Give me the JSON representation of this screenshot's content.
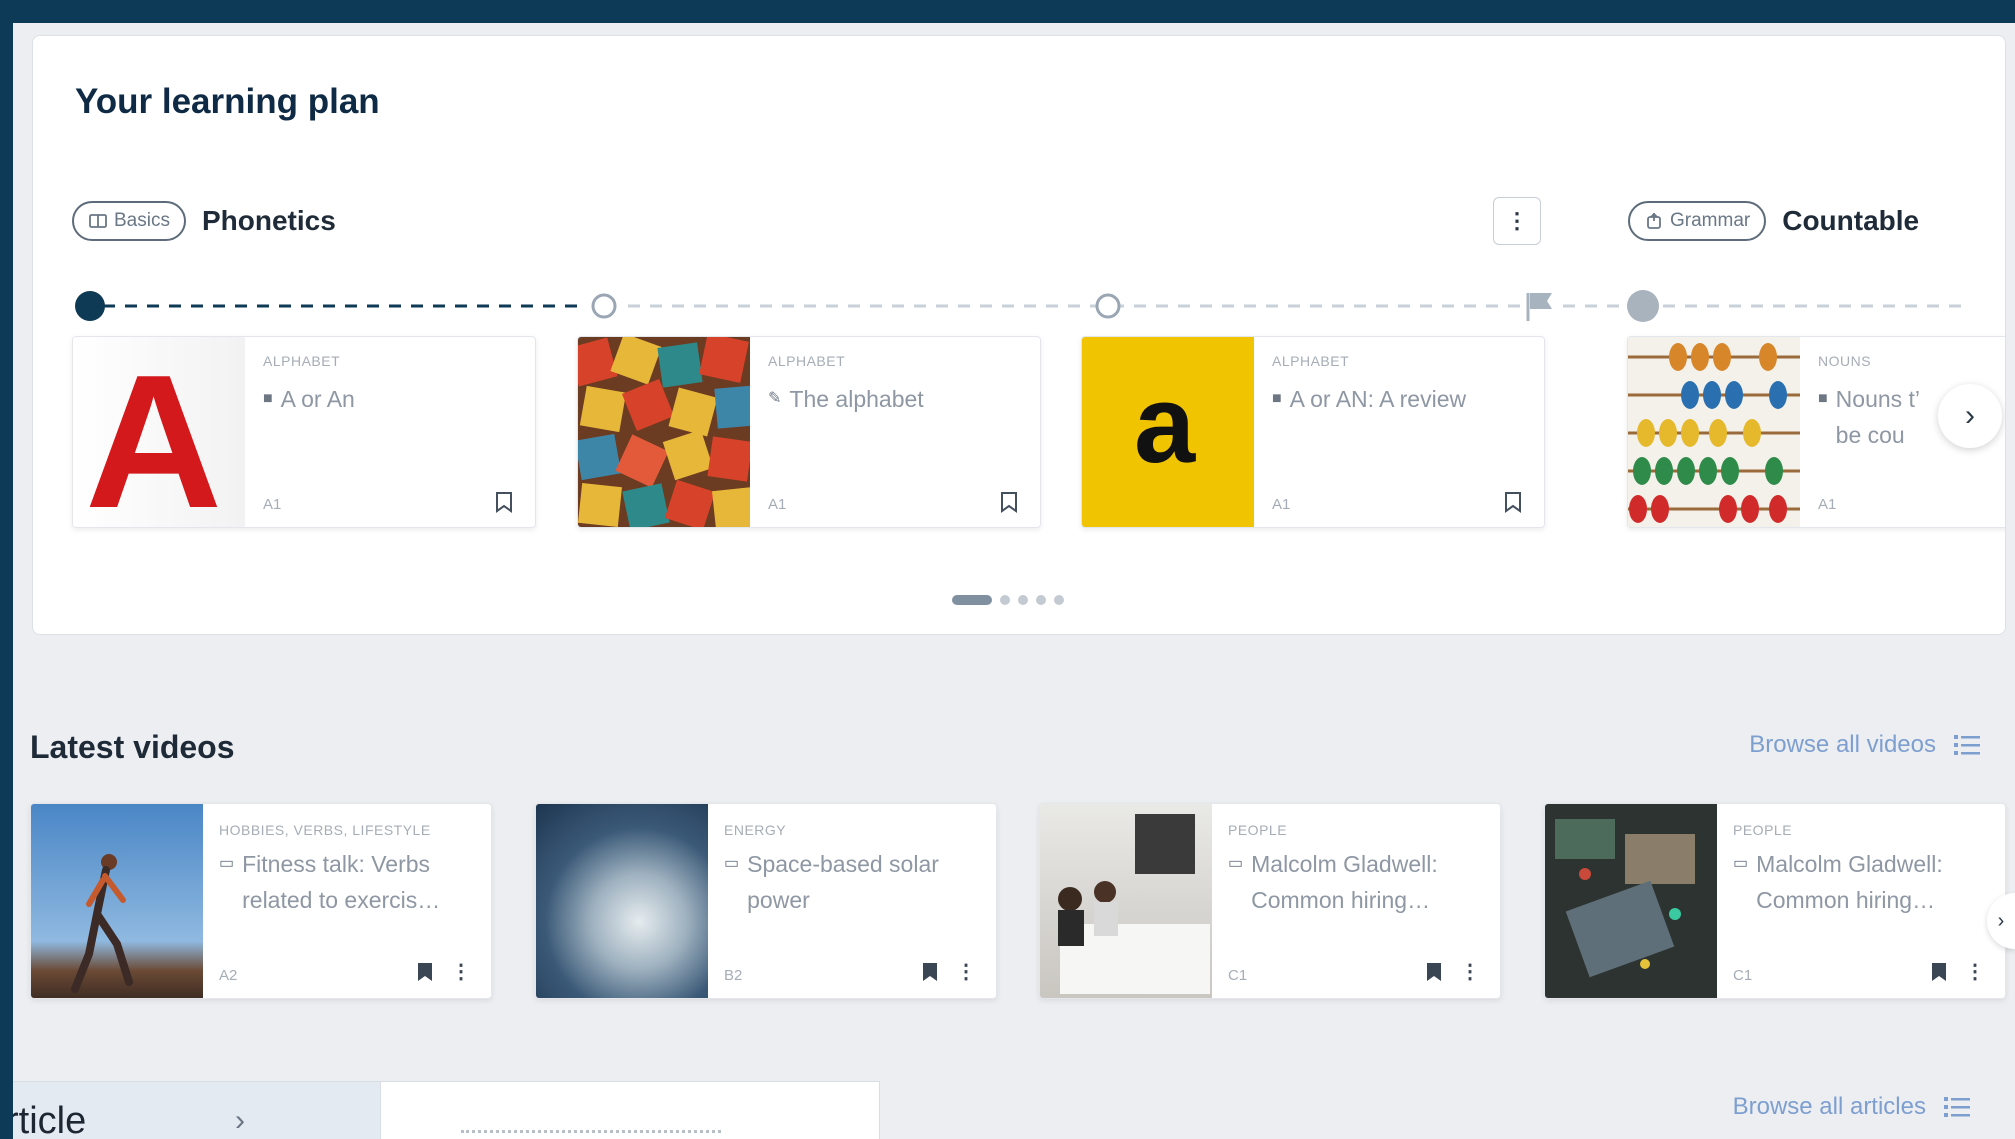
{
  "learning_plan": {
    "title": "Your learning plan",
    "topics": [
      {
        "chip": "Basics",
        "chip_icon": "book-icon",
        "name": "Phonetics"
      },
      {
        "chip": "Grammar",
        "chip_icon": "grammar-icon",
        "name": "Countable"
      }
    ],
    "cards": [
      {
        "category": "ALPHABET",
        "title": "A or An",
        "title_icon": "book-icon",
        "level": "A1",
        "thumb": "letter-a-red"
      },
      {
        "category": "ALPHABET",
        "title": "The alphabet",
        "title_icon": "pen-icon",
        "level": "A1",
        "thumb": "letter-blocks"
      },
      {
        "category": "ALPHABET",
        "title": "A or AN: A review",
        "title_icon": "book-icon",
        "level": "A1",
        "thumb": "letter-a-yellow"
      },
      {
        "category": "NOUNS",
        "title": "Nouns t’ be cou",
        "title_icon": "book-icon",
        "level": "A1",
        "thumb": "abacus"
      }
    ],
    "pagination": {
      "pages": 5,
      "current": 1
    }
  },
  "latest_videos": {
    "title": "Latest videos",
    "browse_label": "Browse all videos",
    "cards": [
      {
        "category": "HOBBIES, VERBS, LIFESTYLE",
        "title": "Fitness talk: Verbs related to exercis…",
        "level": "A2",
        "thumb": "runner"
      },
      {
        "category": "ENERGY",
        "title": "Space-based solar power",
        "level": "B2",
        "thumb": "earth"
      },
      {
        "category": "PEOPLE",
        "title": "Malcolm Gladwell: Common hiring…",
        "level": "C1",
        "thumb": "meeting"
      },
      {
        "category": "PEOPLE",
        "title": "Malcolm Gladwell: Common hiring…",
        "level": "C1",
        "thumb": "circuit"
      }
    ]
  },
  "articles": {
    "browse_label": "Browse all articles",
    "tab_label": "rticle"
  },
  "colors": {
    "frame": "#0d3b57",
    "page_bg": "#eceef1",
    "accent_link": "#7d9fd0",
    "timeline_active": "#0f3a55"
  }
}
